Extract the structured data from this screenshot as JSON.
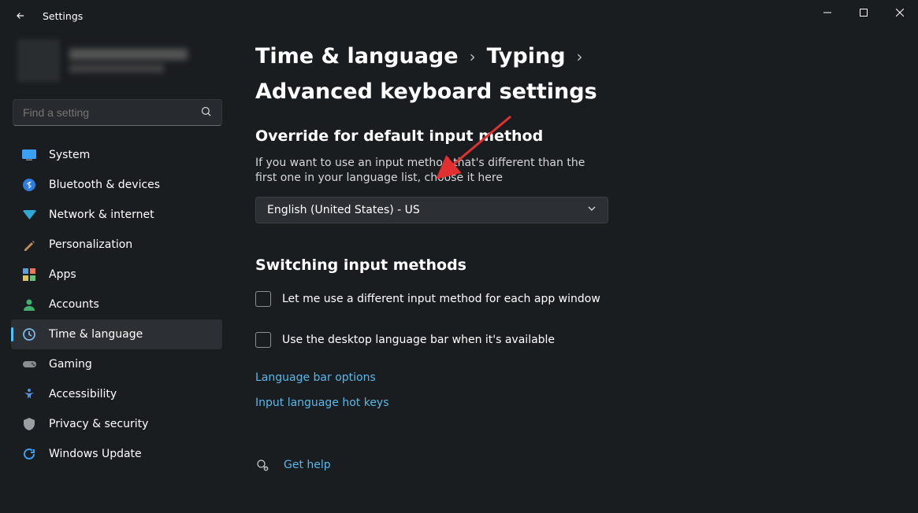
{
  "window": {
    "title": "Settings"
  },
  "search": {
    "placeholder": "Find a setting"
  },
  "sidebar": {
    "items": [
      {
        "label": "System"
      },
      {
        "label": "Bluetooth & devices"
      },
      {
        "label": "Network & internet"
      },
      {
        "label": "Personalization"
      },
      {
        "label": "Apps"
      },
      {
        "label": "Accounts"
      },
      {
        "label": "Time & language"
      },
      {
        "label": "Gaming"
      },
      {
        "label": "Accessibility"
      },
      {
        "label": "Privacy & security"
      },
      {
        "label": "Windows Update"
      }
    ],
    "active_index": 6
  },
  "breadcrumb": {
    "root": "Time & language",
    "mid": "Typing",
    "current": "Advanced keyboard settings"
  },
  "override": {
    "heading": "Override for default input method",
    "desc": "If you want to use an input method that's different than the first one in your language list, choose it here",
    "selected": "English (United States) - US"
  },
  "switching": {
    "heading": "Switching input methods",
    "check1": "Let me use a different input method for each app window",
    "check2": "Use the desktop language bar when it's available",
    "link1": "Language bar options",
    "link2": "Input language hot keys"
  },
  "help": {
    "label": "Get help"
  }
}
